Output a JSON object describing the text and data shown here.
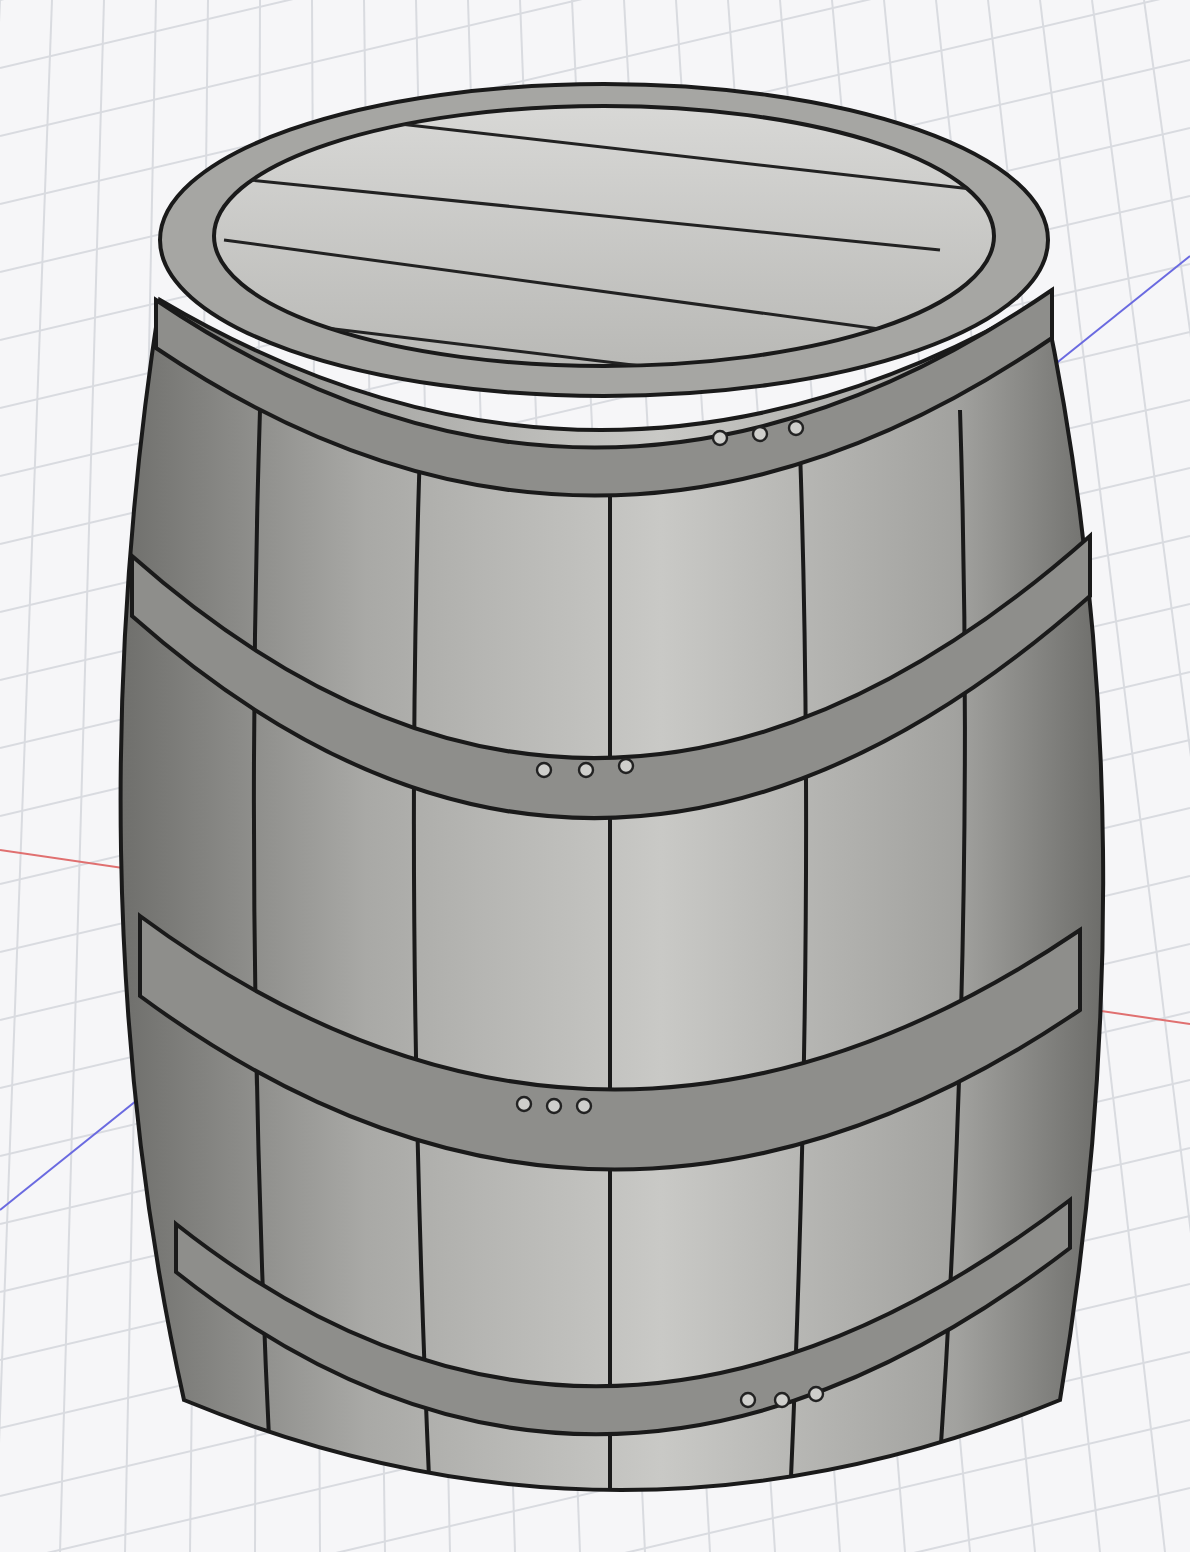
{
  "viewport": {
    "grid_visible": true,
    "axes_visible": true
  }
}
